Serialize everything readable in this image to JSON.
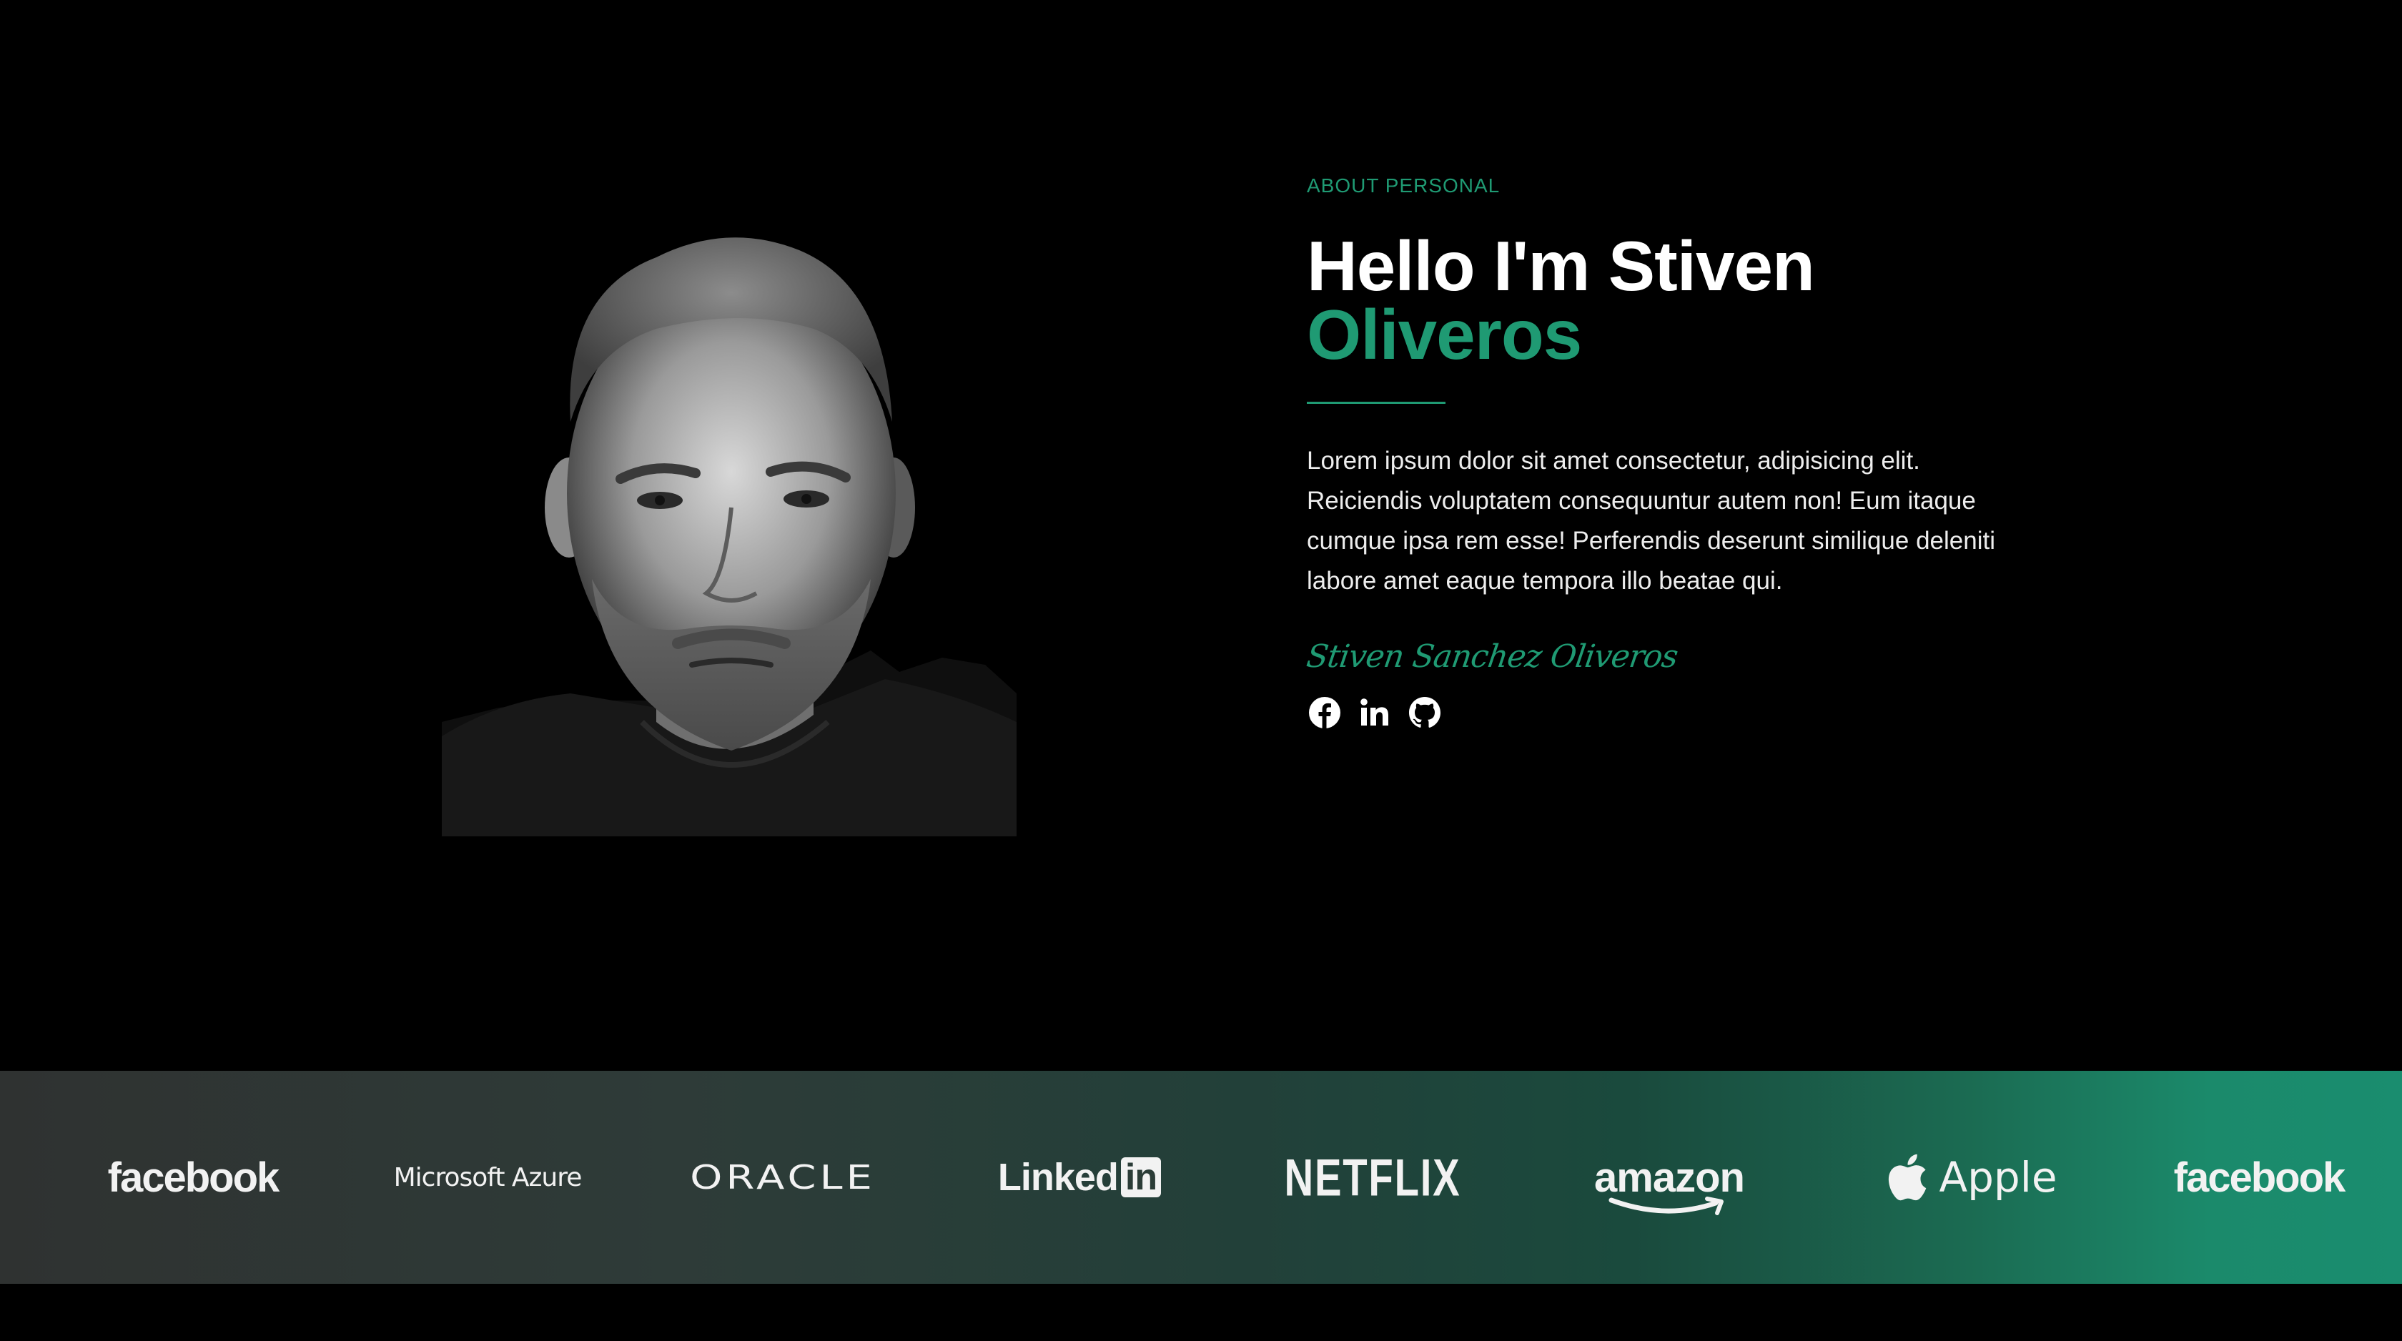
{
  "about": {
    "eyebrow": "ABOUT PERSONAL",
    "headline_line1": "Hello I'm Stiven",
    "headline_line2": "Oliveros",
    "bio": "Lorem ipsum dolor sit amet consectetur, adipisicing elit. Reiciendis voluptatem consequuntur autem non! Eum itaque cumque ipsa rem esse! Perferendis deserunt similique deleniti labore amet eaque tempora illo beatae qui.",
    "signature": "Stiven Sanchez Oliveros",
    "socials": [
      {
        "name": "facebook",
        "icon": "facebook-icon"
      },
      {
        "name": "linkedin",
        "icon": "linkedin-icon"
      },
      {
        "name": "github",
        "icon": "github-icon"
      }
    ]
  },
  "brands": {
    "items": [
      {
        "label": "facebook"
      },
      {
        "label": "Microsoft Azure"
      },
      {
        "label": "ORACLE"
      },
      {
        "label": "Linked",
        "badge": "in"
      },
      {
        "label": "NETFLIX"
      },
      {
        "label": "amazon"
      },
      {
        "label": "Apple",
        "icon": "apple-icon"
      },
      {
        "label": "facebook"
      }
    ]
  },
  "colors": {
    "background": "#000000",
    "accent": "#1f9a73",
    "text": "#ffffff",
    "strip_start": "#2f3231",
    "strip_end": "#1a8d6f"
  }
}
